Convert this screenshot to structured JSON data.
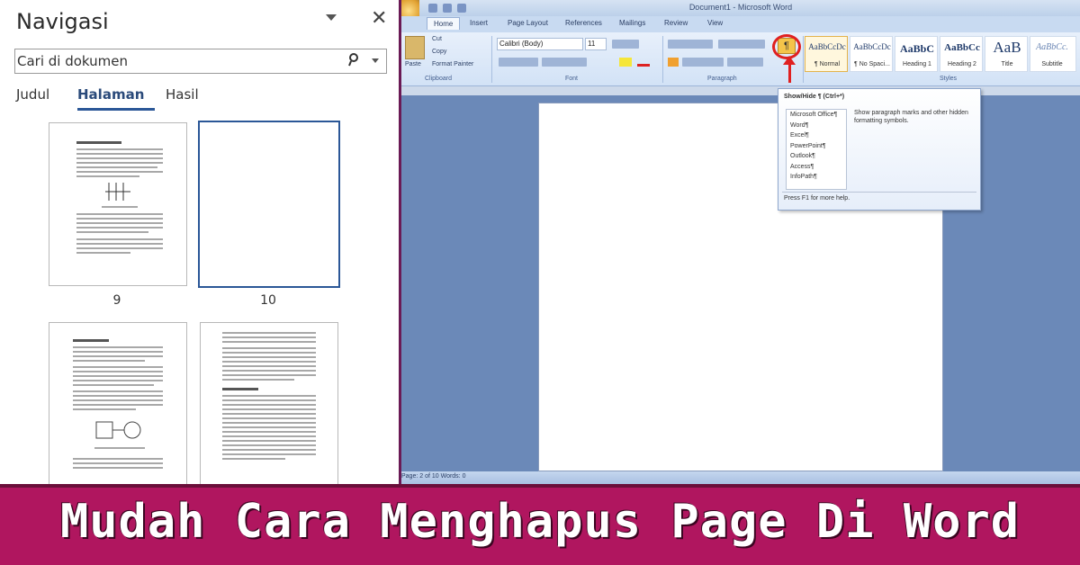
{
  "navigation": {
    "title": "Navigasi",
    "search_placeholder": "Cari di dokumen",
    "tabs": [
      "Judul",
      "Halaman",
      "Hasil"
    ],
    "active_tab": "Halaman",
    "pages": [
      "9",
      "10"
    ]
  },
  "word": {
    "window_title": "Document1 - Microsoft Word",
    "ribbon_tabs": [
      "Home",
      "Insert",
      "Page Layout",
      "References",
      "Mailings",
      "Review",
      "View"
    ],
    "clipboard": {
      "paste": "Paste",
      "cut": "Cut",
      "copy": "Copy",
      "format_painter": "Format Painter",
      "group": "Clipboard"
    },
    "font": {
      "name": "Calibri (Body)",
      "size": "11",
      "group": "Font"
    },
    "paragraph_group": "Paragraph",
    "styles_group": "Styles",
    "styles": [
      {
        "sample": "AaBbCcDc",
        "name": "¶ Normal"
      },
      {
        "sample": "AaBbCcDc",
        "name": "¶ No Spaci..."
      },
      {
        "sample": "AaBbC",
        "name": "Heading 1"
      },
      {
        "sample": "AaBbCc",
        "name": "Heading 2"
      },
      {
        "sample": "AaB",
        "name": "Title"
      },
      {
        "sample": "AaBbCc.",
        "name": "Subtitle"
      }
    ],
    "tooltip": {
      "title": "Show/Hide ¶ (Ctrl+*)",
      "list": [
        "Microsoft Office¶",
        "Word¶",
        "Excel¶",
        "PowerPoint¶",
        "Outlook¶",
        "Access¶",
        "InfoPath¶"
      ],
      "description": "Show paragraph marks and other hidden formatting symbols.",
      "help": "Press F1 for more help."
    },
    "status": "Page: 2 of 10   Words: 0"
  },
  "banner": {
    "text": "Mudah Cara Menghapus Page Di Word"
  },
  "colors": {
    "banner": "#b0165f",
    "accent": "#2b5797",
    "highlight": "#e02020"
  }
}
